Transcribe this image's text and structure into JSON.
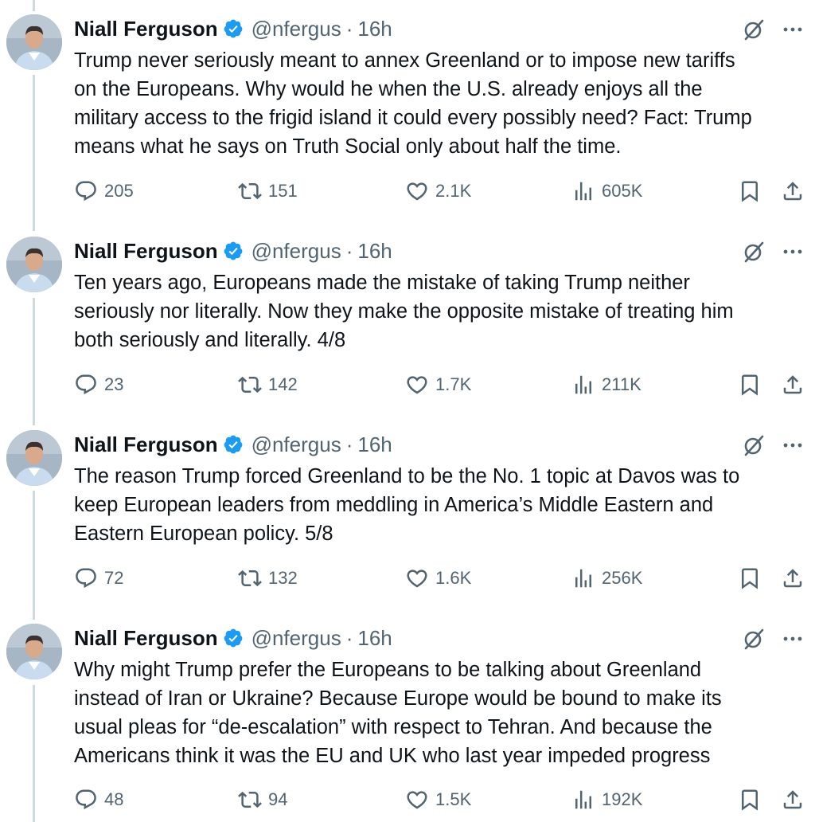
{
  "tweets": [
    {
      "author": {
        "name": "Niall Ferguson",
        "handle": "@nfergus",
        "separator": "·",
        "time": "16h"
      },
      "text": "Trump never seriously meant to annex Greenland or to impose new tariffs\non the Europeans. Why would he when the U.S. already enjoys all the\nmilitary access to the frigid island it could every possibly need? Fact: Trump\nmeans what he says on Truth Social only about half the time.",
      "stats": {
        "replies": "205",
        "reposts": "151",
        "likes": "2.1K",
        "views": "605K"
      }
    },
    {
      "author": {
        "name": "Niall Ferguson",
        "handle": "@nfergus",
        "separator": "·",
        "time": "16h"
      },
      "text": "Ten years ago, Europeans made the mistake of taking Trump neither\nseriously nor literally. Now they make the opposite mistake of treating him\nboth seriously and literally. 4/8",
      "stats": {
        "replies": "23",
        "reposts": "142",
        "likes": "1.7K",
        "views": "211K"
      }
    },
    {
      "author": {
        "name": "Niall Ferguson",
        "handle": "@nfergus",
        "separator": "·",
        "time": "16h"
      },
      "text": "The reason Trump forced Greenland to be the No. 1 topic at Davos was to\nkeep European leaders from meddling in America’s Middle Eastern and\nEastern European policy. 5/8",
      "stats": {
        "replies": "72",
        "reposts": "132",
        "likes": "1.6K",
        "views": "256K"
      }
    },
    {
      "author": {
        "name": "Niall Ferguson",
        "handle": "@nfergus",
        "separator": "·",
        "time": "16h"
      },
      "text": "Why might Trump prefer the Europeans to be talking about Greenland\ninstead of Iran or Ukraine? Because Europe would be bound to make its\nusual pleas for “de-escalation” with respect to Tehran. And because the\nAmericans think it was the EU and UK who last year impeded progress",
      "stats": {
        "replies": "48",
        "reposts": "94",
        "likes": "1.5K",
        "views": "192K"
      }
    }
  ],
  "colors": {
    "text": "#0f1419",
    "secondary": "#536471",
    "verified": "#1d9bf0",
    "thread_line": "#cfd9de"
  },
  "icons": [
    "verified-badge-icon",
    "grok-icon",
    "more-icon",
    "reply-icon",
    "repost-icon",
    "like-icon",
    "views-icon",
    "bookmark-icon",
    "share-icon"
  ]
}
